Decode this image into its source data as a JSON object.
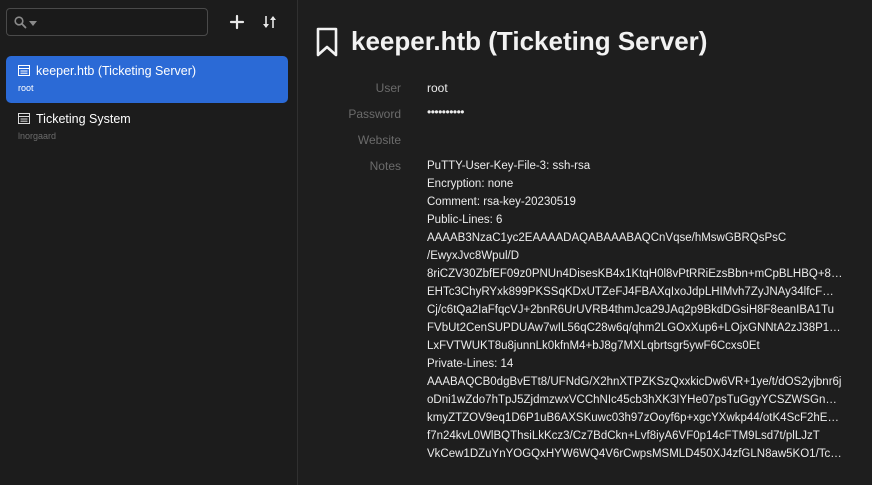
{
  "search": {
    "value": "",
    "placeholder": ""
  },
  "entries": [
    {
      "title": "keeper.htb (Ticketing Server)",
      "subtitle": "root"
    },
    {
      "title": "Ticketing System",
      "subtitle": "lnorgaard"
    }
  ],
  "detail": {
    "title": "keeper.htb (Ticketing Server)",
    "fields": {
      "user_label": "User",
      "user_value": "root",
      "password_label": "Password",
      "password_value": "••••••••••",
      "website_label": "Website",
      "website_value": "",
      "notes_label": "Notes"
    },
    "notes": [
      "PuTTY-User-Key-File-3: ssh-rsa",
      "Encryption: none",
      "Comment: rsa-key-20230519",
      "Public-Lines: 6",
      "AAAAB3NzaC1yc2EAAAADAQABAAABAQCnVqse/hMswGBRQsPsC",
      "/EwyxJvc8Wpul/D",
      "8riCZV30ZbfEF09z0PNUn4DisesKB4x1KtqH0l8vPtRRiEzsBbn+mCpBLHBQ+8…",
      "EHTc3ChyRYxk899PKSSqKDxUTZeFJ4FBAXqIxoJdpLHIMvh7ZyJNAy34lfcF…",
      "Cj/c6tQa2IaFfqcVJ+2bnR6UrUVRB4thmJca29JAq2p9BkdDGsiH8F8eanIBA1Tu",
      "FVbUt2CenSUPDUAw7wIL56qC28w6q/qhm2LGOxXup6+LOjxGNNtA2zJ38P1…",
      "LxFVTWUKT8u8junnLk0kfnM4+bJ8g7MXLqbrtsgr5ywF6Ccxs0Et",
      "Private-Lines: 14",
      "AAABAQCB0dgBvETt8/UFNdG/X2hnXTPZKSzQxxkicDw6VR+1ye/t/dOS2yjbnr6j",
      "oDni1wZdo7hTpJ5ZjdmzwxVCChNIc45cb3hXK3IYHe07psTuGgyYCSZWSGn…",
      "kmyZTZOV9eq1D6P1uB6AXSKuwc03h97zOoyf6p+xgcYXwkp44/otK4ScF2hE…",
      "f7n24kvL0WlBQThsiLkKcz3/Cz7BdCkn+Lvf8iyA6VF0p14cFTM9Lsd7t/plLJzT",
      "VkCew1DZuYnYOGQxHYW6WQ4V6rCwpsMSMLD450XJ4zfGLN8aw5KO1/Tc…"
    ]
  },
  "colors": {
    "accent": "#2b6ad6",
    "background": "#1e1e1e",
    "sidebar": "#1c1c1c",
    "label": "#6b6b6b"
  },
  "icons": {
    "search": "search-icon",
    "caret": "chevron-down-icon",
    "add": "plus-icon",
    "sort": "sort-icon",
    "entry": "key-entry-icon",
    "bookmark": "bookmark-icon"
  }
}
